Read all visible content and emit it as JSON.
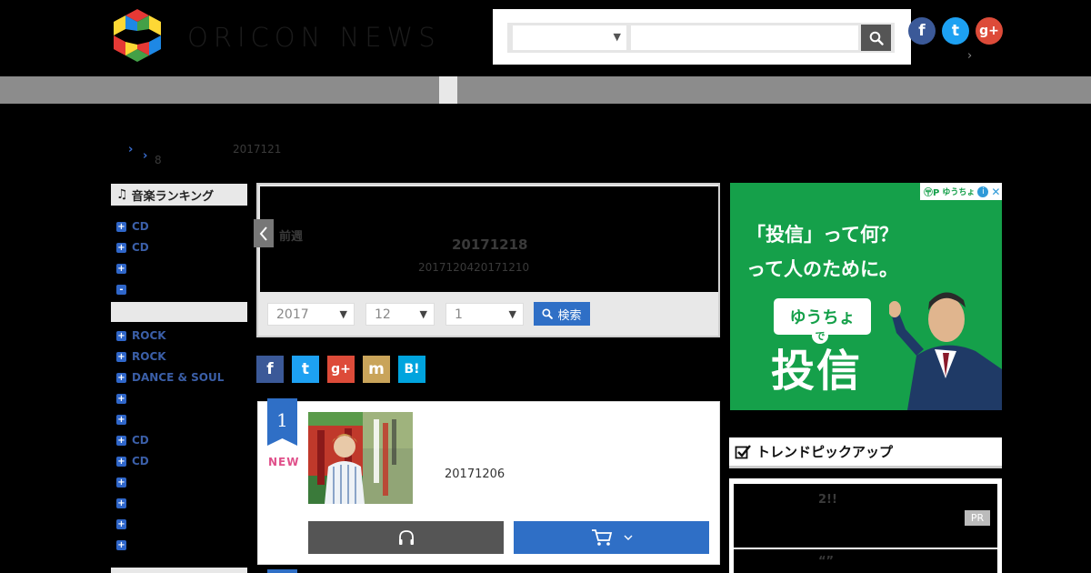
{
  "header": {
    "logo_text": "ORICON NEWS",
    "search": {
      "category_value": "",
      "query_value": "",
      "query_placeholder": ""
    },
    "social": [
      {
        "name": "facebook",
        "glyph": "f",
        "color": "#3b5998"
      },
      {
        "name": "twitter",
        "glyph": "t",
        "color": "#1da1f2"
      },
      {
        "name": "google-plus",
        "glyph": "g+",
        "color": "#dd4b39"
      }
    ]
  },
  "breadcrumb": {
    "line2_text": "8",
    "date_text": "2017121"
  },
  "sidebar": {
    "heading": "音楽ランキング",
    "group1": [
      {
        "box": "+",
        "label": "CD"
      },
      {
        "box": "+",
        "label": "CD"
      },
      {
        "box": "+",
        "label": ""
      },
      {
        "box": "-",
        "label": ""
      }
    ],
    "group2": [
      {
        "box": "+",
        "label": "ROCK"
      },
      {
        "box": "+",
        "label": "ROCK"
      },
      {
        "box": "+",
        "label": "DANCE & SOUL"
      },
      {
        "box": "+",
        "label": ""
      },
      {
        "box": "+",
        "label": ""
      },
      {
        "box": "+",
        "label": "CD"
      },
      {
        "box": "+",
        "label": "CD"
      },
      {
        "box": "+",
        "label": ""
      },
      {
        "box": "+",
        "label": ""
      },
      {
        "box": "+",
        "label": ""
      },
      {
        "box": "+",
        "label": ""
      }
    ]
  },
  "week": {
    "prev_label": "前週",
    "date": "20171218",
    "range": "2017120420171210",
    "year": "2017",
    "month": "12",
    "week_no": "1",
    "search_label": "検索"
  },
  "share": [
    {
      "name": "facebook",
      "glyph": "f",
      "color": "#3b5998"
    },
    {
      "name": "twitter",
      "glyph": "t",
      "color": "#1da1f2"
    },
    {
      "name": "google-plus",
      "glyph": "g+",
      "color": "#dd4b39"
    },
    {
      "name": "mixi",
      "glyph": "m",
      "color": "#c9a45a"
    },
    {
      "name": "hatena",
      "glyph": "B!",
      "color": "#00a4de"
    }
  ],
  "ranking": {
    "rank": "1",
    "badge": "NEW",
    "release_date": "20171206"
  },
  "ad": {
    "headline_line1": "「投信」って何？",
    "headline_line2": "って人のために。",
    "badge_text": "ゆうちょ",
    "de_text": "で",
    "big_text": "投信",
    "topbar_brand": "ゆうちょ"
  },
  "trend": {
    "heading": "トレンドピックアップ",
    "item1": "2!!",
    "item2": "“”",
    "pr_badge": "PR"
  }
}
